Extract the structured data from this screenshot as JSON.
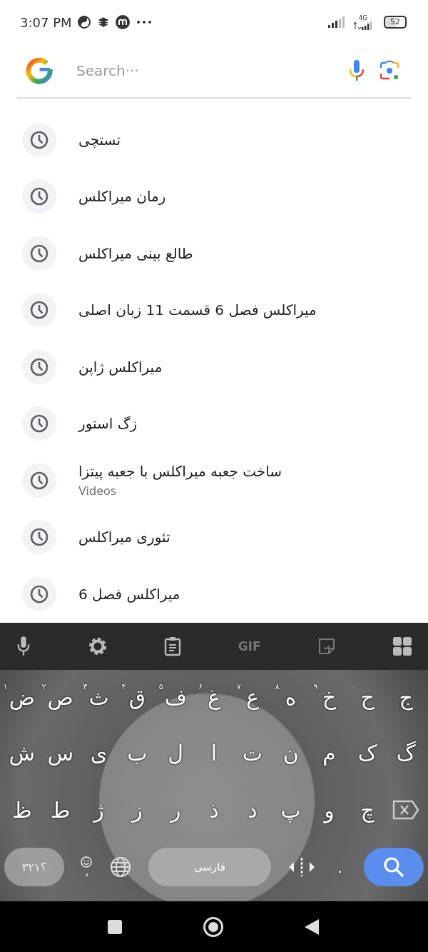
{
  "status_bar": {
    "time": "3:07 PM",
    "network": "4G",
    "battery": "52"
  },
  "search": {
    "placeholder": "Search···"
  },
  "suggestions": [
    {
      "text": "تستچی"
    },
    {
      "text": "رمان میراکلس"
    },
    {
      "text": "طالع بینی میراکلس"
    },
    {
      "text": "میراکلس فصل 6 قسمت 11 زبان اصلی"
    },
    {
      "text": "میراکلس ژاپن"
    },
    {
      "text": "زگ استور"
    },
    {
      "text": "ساخت جعبه میراکلس با جعبه پیتزا",
      "subtitle": "Videos"
    },
    {
      "text": "تئوری میراکلس"
    },
    {
      "text": "میراکلس فصل 6"
    }
  ],
  "keyboard": {
    "toolbar_gif": "GIF",
    "rows": [
      [
        {
          "kind": "letter",
          "key": "ج"
        },
        {
          "kind": "letter",
          "key": "ح",
          "hint": "۰"
        },
        {
          "kind": "letter",
          "key": "خ",
          "hint": "۹"
        },
        {
          "kind": "letter",
          "key": "ه",
          "hint": "۸"
        },
        {
          "kind": "letter",
          "key": "ع",
          "hint": "۷"
        },
        {
          "kind": "letter",
          "key": "غ",
          "hint": "۶"
        },
        {
          "kind": "letter",
          "key": "ف",
          "hint": "۵"
        },
        {
          "kind": "letter",
          "key": "ق",
          "hint": "۴"
        },
        {
          "kind": "letter",
          "key": "ث",
          "hint": "۳"
        },
        {
          "kind": "letter",
          "key": "ص",
          "hint": "۲"
        },
        {
          "kind": "letter",
          "key": "ض",
          "hint": "۱"
        }
      ],
      [
        {
          "kind": "letter",
          "key": "گ"
        },
        {
          "kind": "letter",
          "key": "ک"
        },
        {
          "kind": "letter",
          "key": "م"
        },
        {
          "kind": "letter",
          "key": "ن"
        },
        {
          "kind": "letter",
          "key": "ت"
        },
        {
          "kind": "letter",
          "key": "ا"
        },
        {
          "kind": "letter",
          "key": "ل"
        },
        {
          "kind": "letter",
          "key": "ب"
        },
        {
          "kind": "letter",
          "key": "ی"
        },
        {
          "kind": "letter",
          "key": "س"
        },
        {
          "kind": "letter",
          "key": "ش"
        }
      ],
      [
        {
          "kind": "backspace"
        },
        {
          "kind": "letter",
          "key": "چ"
        },
        {
          "kind": "letter",
          "key": "و"
        },
        {
          "kind": "letter",
          "key": "پ"
        },
        {
          "kind": "letter",
          "key": "د"
        },
        {
          "kind": "letter",
          "key": "ذ"
        },
        {
          "kind": "letter",
          "key": "ر"
        },
        {
          "kind": "letter",
          "key": "ز"
        },
        {
          "kind": "letter",
          "key": "ژ"
        },
        {
          "kind": "letter",
          "key": "ط"
        },
        {
          "kind": "letter",
          "key": "ظ"
        }
      ]
    ],
    "period_key": ".",
    "comma_key": "،",
    "space_label": "فارسی",
    "symbols_key": "؟۳۲۱"
  }
}
